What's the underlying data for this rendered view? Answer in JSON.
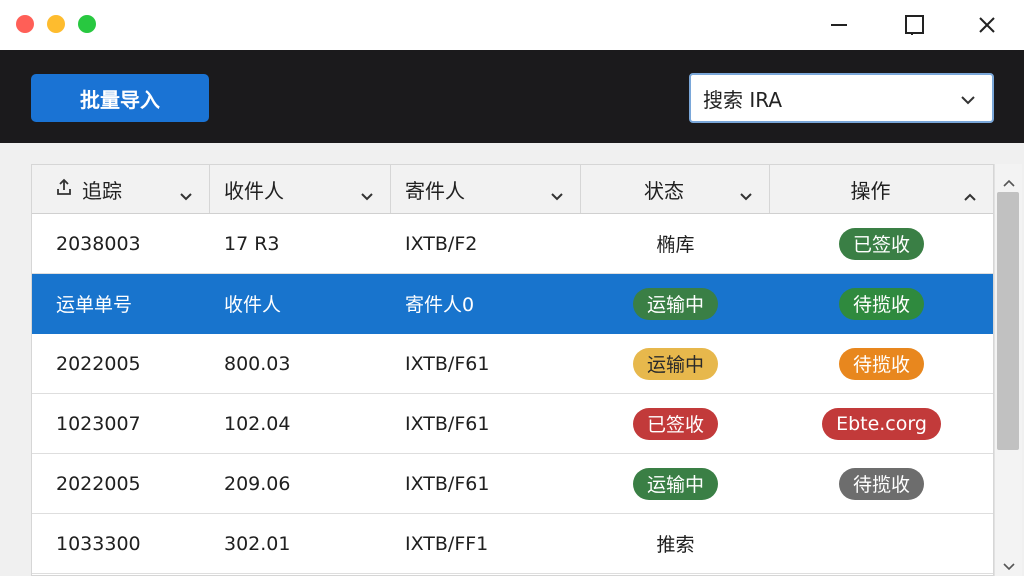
{
  "window": {
    "minimize_icon": "minimize-icon",
    "maximize_icon": "maximize-icon",
    "close_icon": "close-icon"
  },
  "toolbar": {
    "import_label": "批量导入",
    "search_value": "搜索 IRA",
    "accent": "#1a73d4",
    "background": "#1b1a1c"
  },
  "table": {
    "columns": [
      {
        "label": "追踪",
        "sort": "down"
      },
      {
        "label": "收件人",
        "sort": "down"
      },
      {
        "label": "寄件人",
        "sort": "down"
      },
      {
        "label": "状态",
        "sort": "down"
      },
      {
        "label": "操作",
        "sort": "up"
      }
    ],
    "rows": [
      {
        "id": "2038003",
        "recipient": "17 R3",
        "sender": "IXTB/F2",
        "status": "椭库",
        "status_style": "text",
        "action": "已签收",
        "action_style": "green",
        "selected": false
      },
      {
        "id": "运单单号",
        "recipient": "收件人",
        "sender": "寄件人0",
        "status": "运输中",
        "status_style": "green",
        "action": "待揽收",
        "action_style": "green-bright",
        "selected": true
      },
      {
        "id": "2022005",
        "recipient": "800.03",
        "sender": "IXTB/F61",
        "status": "运输中",
        "status_style": "yellow",
        "action": "待揽收",
        "action_style": "orange",
        "selected": false
      },
      {
        "id": "1023007",
        "recipient": "102.04",
        "sender": "IXTB/F61",
        "status": "已签收",
        "status_style": "red",
        "action": "Ebte.corg",
        "action_style": "red",
        "selected": false
      },
      {
        "id": "2022005",
        "recipient": "209.06",
        "sender": "IXTB/F61",
        "status": "运输中",
        "status_style": "green",
        "action": "待揽收",
        "action_style": "gray",
        "selected": false
      },
      {
        "id": "1033300",
        "recipient": "302.01",
        "sender": "IXTB/FF1",
        "status": "推索",
        "status_style": "text",
        "action": "",
        "action_style": "none",
        "selected": false
      }
    ]
  },
  "colors": {
    "selected_row": "#1874cd",
    "green": "#3a7f45",
    "yellow": "#e7b84c",
    "orange": "#e8871e",
    "red": "#c23a3a",
    "gray": "#6d6d6d"
  }
}
